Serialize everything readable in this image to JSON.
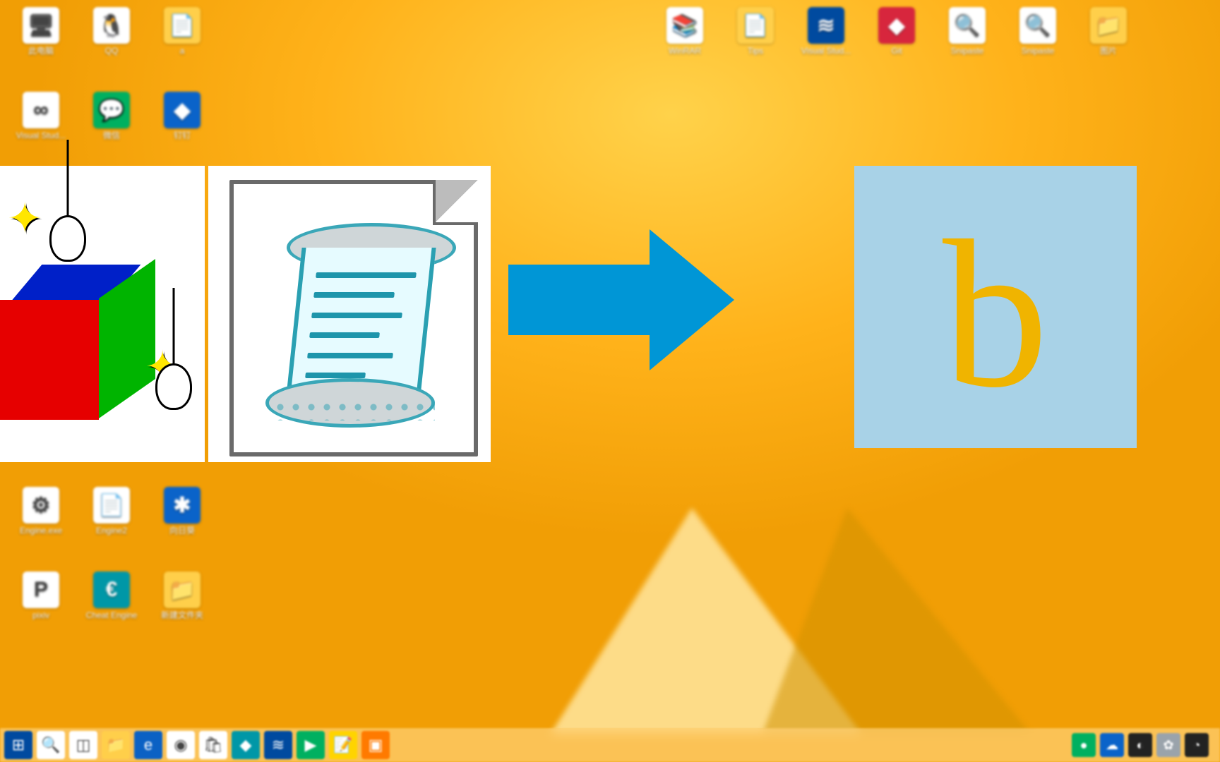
{
  "desktopIcons": {
    "left": [
      {
        "label": "此电脑",
        "glyph": "🖥",
        "cls": "g-white"
      },
      {
        "label": "QQ",
        "glyph": "🐧",
        "cls": "g-white"
      },
      {
        "label": "a",
        "glyph": "📄",
        "cls": "g-folder"
      },
      {
        "label": "Visual Stud...",
        "glyph": "∞",
        "cls": "g-white"
      },
      {
        "label": "微信",
        "glyph": "💬",
        "cls": "g-green"
      },
      {
        "label": "钉钉",
        "glyph": "◆",
        "cls": "g-blue"
      }
    ],
    "leftRow3": [
      {
        "label": "Engine.exe",
        "glyph": "⚙",
        "cls": "g-white"
      },
      {
        "label": "Engine2",
        "glyph": "📄",
        "cls": "g-white"
      },
      {
        "label": "向日葵",
        "glyph": "✱",
        "cls": "g-blue"
      }
    ],
    "leftRow4": [
      {
        "label": "pixiv",
        "glyph": "P",
        "cls": "g-white"
      },
      {
        "label": "Cheat Engine",
        "glyph": "€",
        "cls": "g-teal"
      },
      {
        "label": "新建文件夹",
        "glyph": "📁",
        "cls": "g-folder"
      }
    ],
    "right": [
      {
        "label": "WinRAR",
        "glyph": "📚",
        "cls": "g-white"
      },
      {
        "label": "Tips",
        "glyph": "📄",
        "cls": "g-folder"
      },
      {
        "label": "Visual Stud...",
        "glyph": "≋",
        "cls": "g-dblue"
      },
      {
        "label": "Git",
        "glyph": "◆",
        "cls": "g-red"
      },
      {
        "label": "Snipaste",
        "glyph": "🔍",
        "cls": "g-white"
      },
      {
        "label": "Snipaste",
        "glyph": "🔍",
        "cls": "g-white"
      },
      {
        "label": "图片",
        "glyph": "📁",
        "cls": "g-folder"
      }
    ]
  },
  "overlay": {
    "bTileLetter": "b"
  },
  "taskbar": {
    "items": [
      {
        "name": "start-button",
        "glyph": "⊞",
        "cls": "g-dblue"
      },
      {
        "name": "search-button",
        "glyph": "🔍",
        "cls": "g-white"
      },
      {
        "name": "task-view-button",
        "glyph": "◫",
        "cls": "g-white"
      },
      {
        "name": "explorer-button",
        "glyph": "📁",
        "cls": "g-folder"
      },
      {
        "name": "edge-button",
        "glyph": "e",
        "cls": "g-edge"
      },
      {
        "name": "chrome-button",
        "glyph": "◉",
        "cls": "g-white"
      },
      {
        "name": "store-button",
        "glyph": "🛍",
        "cls": "g-white"
      },
      {
        "name": "task-app",
        "glyph": "◆",
        "cls": "g-teal"
      },
      {
        "name": "vscode-button",
        "glyph": "≋",
        "cls": "g-dblue"
      },
      {
        "name": "play-button",
        "glyph": "▶",
        "cls": "g-green"
      },
      {
        "name": "notes-button",
        "glyph": "📝",
        "cls": "g-yellow"
      },
      {
        "name": "video-button",
        "glyph": "▣",
        "cls": "g-orange"
      }
    ],
    "tray": [
      {
        "name": "tray-app-1",
        "glyph": "●",
        "cls": "g-green"
      },
      {
        "name": "tray-app-2",
        "glyph": "☁",
        "cls": "g-blue"
      },
      {
        "name": "tray-app-3",
        "glyph": "◐",
        "cls": "g-dark"
      },
      {
        "name": "tray-app-4",
        "glyph": "✿",
        "cls": "g-grey"
      },
      {
        "name": "tray-app-5",
        "glyph": "◔",
        "cls": "g-dark"
      }
    ]
  }
}
